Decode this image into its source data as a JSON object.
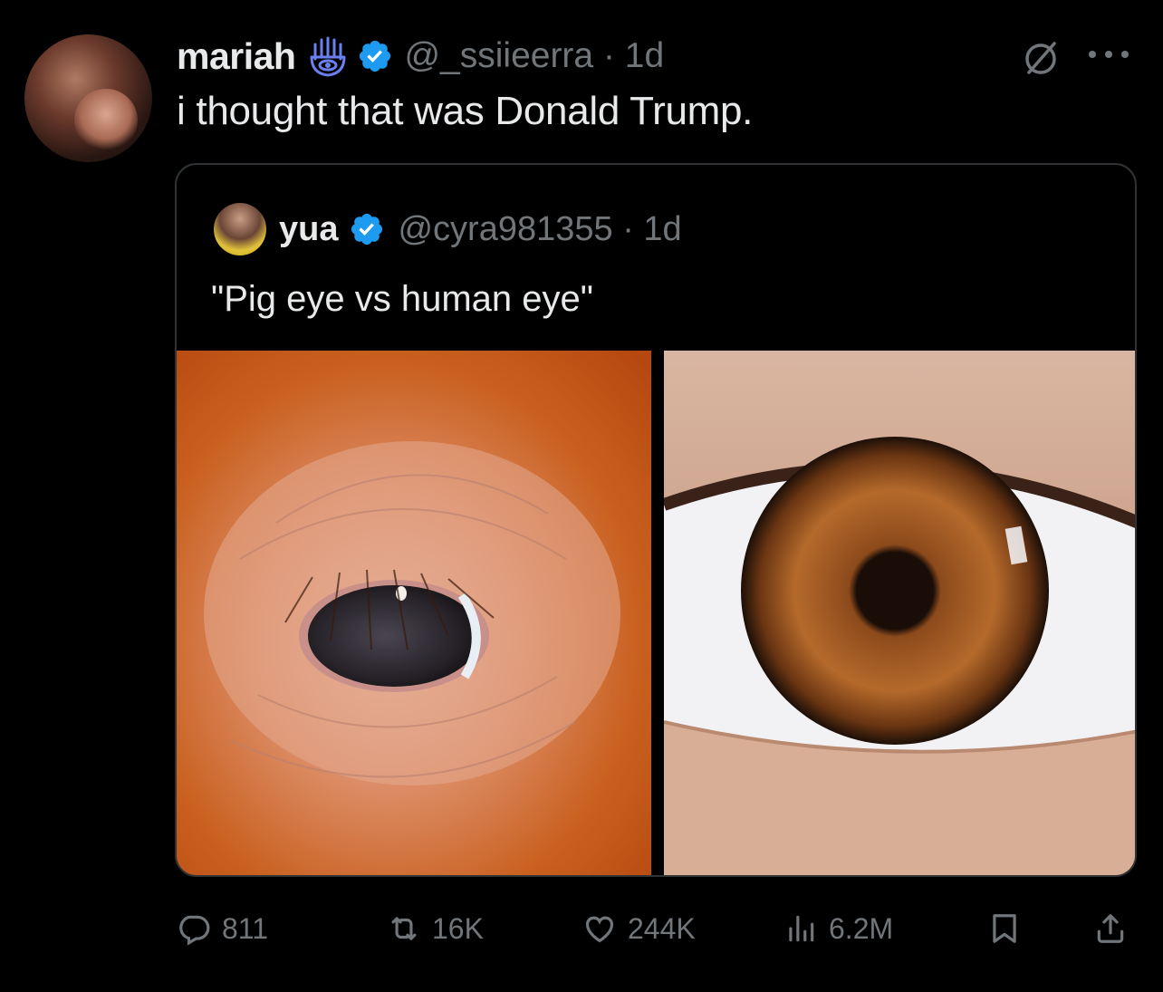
{
  "tweet": {
    "author_name": "mariah",
    "handle_time": "@_ssiieerra · 1d",
    "text": "i thought that was Donald Trump."
  },
  "quote": {
    "author_name": "yua",
    "handle_time": "@cyra981355 · 1d",
    "text": "\"Pig eye vs human eye\""
  },
  "actions": {
    "replies": "811",
    "reposts": "16K",
    "likes": "244K",
    "views": "6.2M"
  },
  "colors": {
    "background": "#000000",
    "text": "#e7e9ea",
    "muted": "#71767b",
    "verified": "#1d9bf0",
    "hamsa": "#6b7ff0",
    "border": "#2f3336"
  }
}
